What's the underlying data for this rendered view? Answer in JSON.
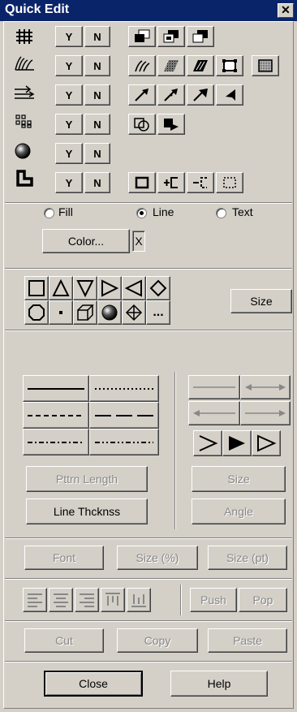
{
  "window": {
    "title": "Quick Edit",
    "close_glyph": "✕"
  },
  "toggles": {
    "yes": "Y",
    "no": "N"
  },
  "rows": [
    {
      "icon": "grid-icon"
    },
    {
      "icon": "hatch-pattern-icon"
    },
    {
      "icon": "arrow-lines-icon"
    },
    {
      "icon": "dot-pattern-icon"
    },
    {
      "icon": "shaded-sphere-icon"
    },
    {
      "icon": "corner-frame-icon"
    }
  ],
  "radios": {
    "fill": "Fill",
    "line": "Line",
    "text": "Text",
    "selected": "line"
  },
  "color_button": "Color...",
  "color_clear": "X",
  "more_shapes": "...",
  "shape_size_button": "Size",
  "line_buttons": {
    "pattern_length": "Pttrn Length",
    "line_thickness": "Line Thcknss"
  },
  "arrow_buttons": {
    "size": "Size",
    "angle": "Angle"
  },
  "font_buttons": {
    "font": "Font",
    "size_percent": "Size (%)",
    "size_pt": "Size (pt)"
  },
  "stack_buttons": {
    "push": "Push",
    "pop": "Pop"
  },
  "edit_buttons": {
    "cut": "Cut",
    "copy": "Copy",
    "paste": "Paste"
  },
  "footer": {
    "close": "Close",
    "help": "Help"
  }
}
